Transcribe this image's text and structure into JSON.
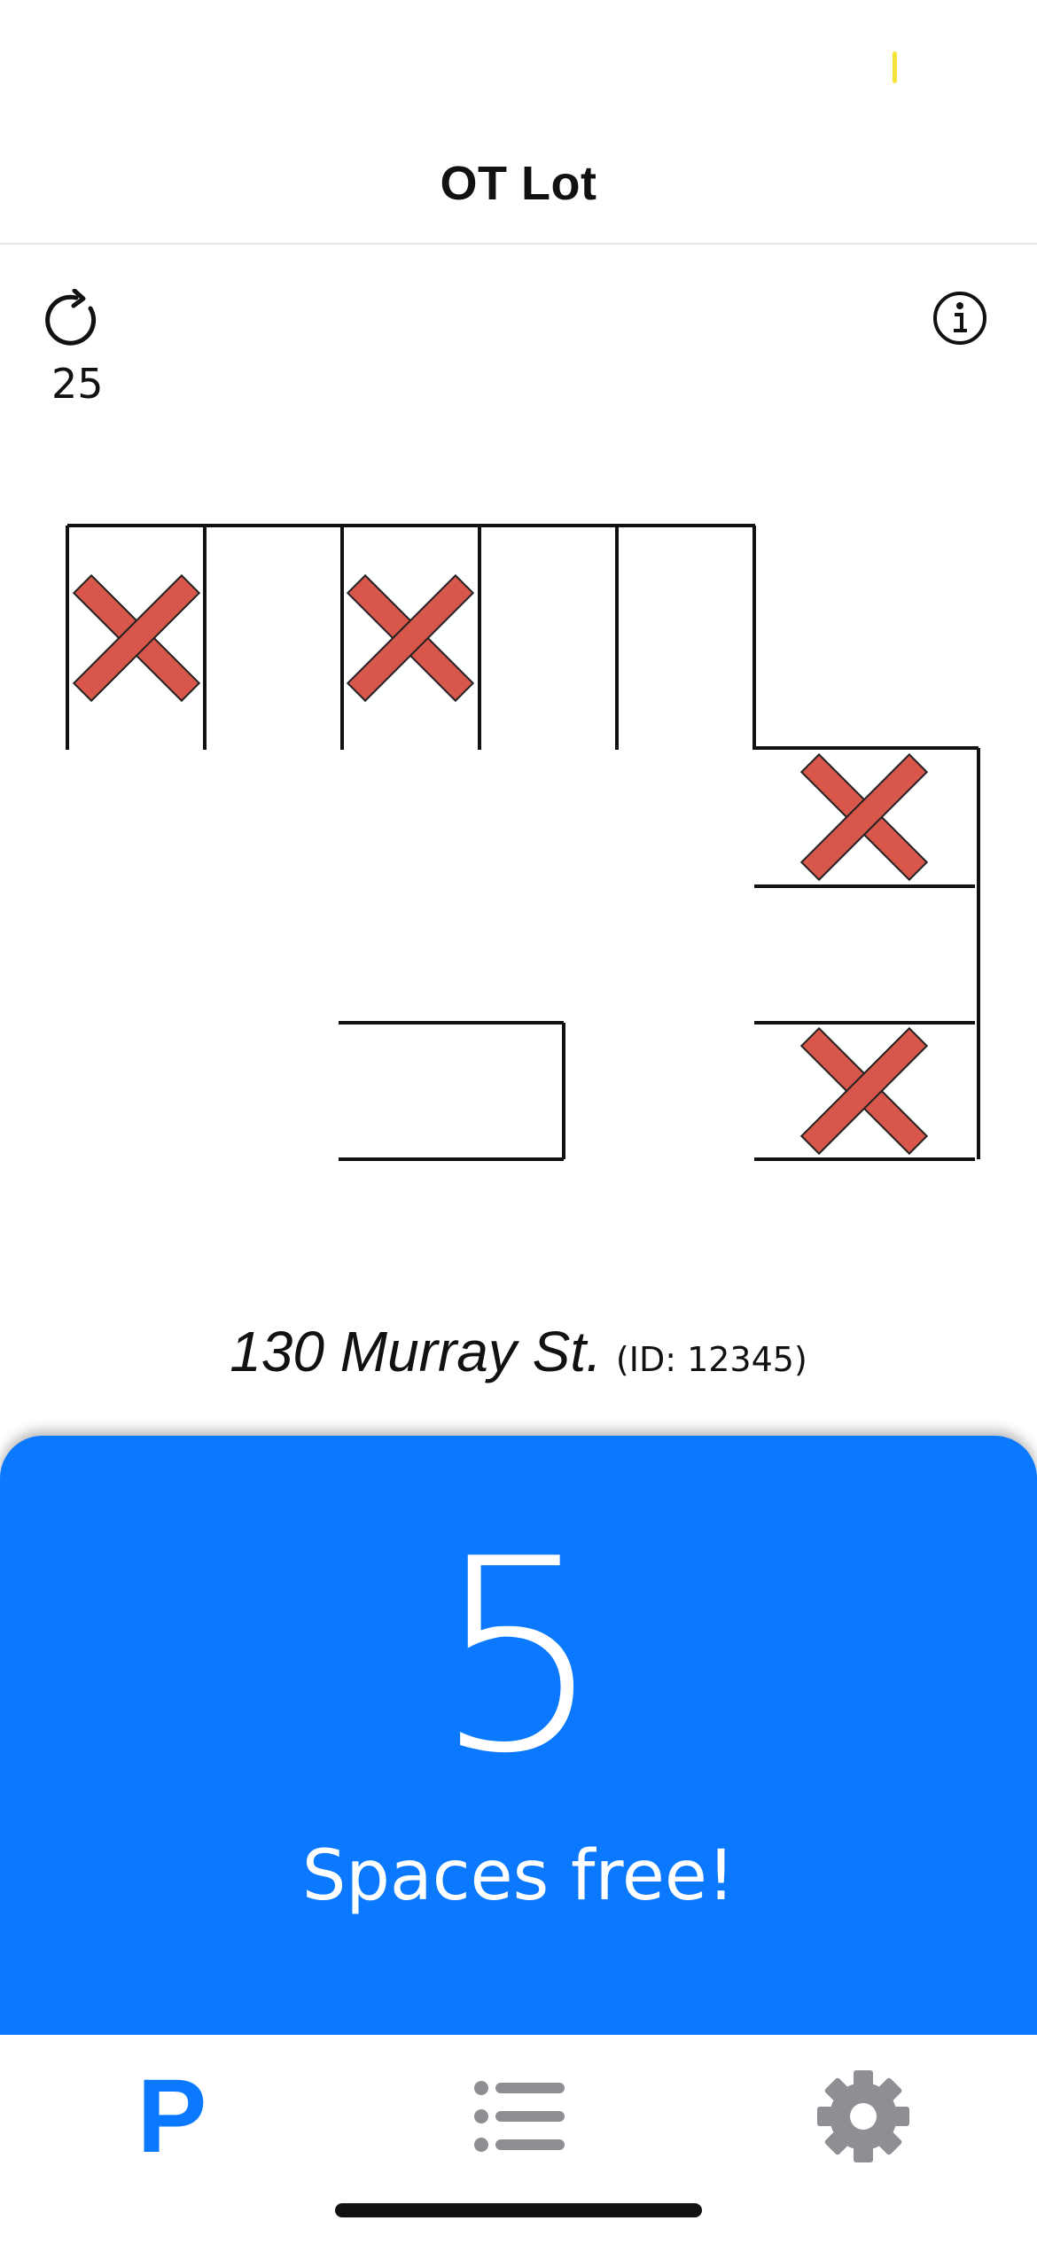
{
  "nav": {
    "title": "OT Lot"
  },
  "refresh": {
    "count": "25"
  },
  "lot": {
    "address": "130 Murray St.",
    "id_label": "(ID: 12345)",
    "occupied_color": "#d9574a",
    "spaces": [
      {
        "name": "space-top-1",
        "occupied": true
      },
      {
        "name": "space-top-2",
        "occupied": false
      },
      {
        "name": "space-top-3",
        "occupied": true
      },
      {
        "name": "space-top-4",
        "occupied": false
      },
      {
        "name": "space-top-5",
        "occupied": false
      },
      {
        "name": "space-right-1",
        "occupied": true
      },
      {
        "name": "space-right-2",
        "occupied": false
      },
      {
        "name": "space-right-3",
        "occupied": true
      },
      {
        "name": "space-middle-1",
        "occupied": false
      }
    ]
  },
  "summary": {
    "free_count": "5",
    "free_label": "Spaces free!",
    "panel_color": "#0a79ff"
  },
  "tabs": {
    "parking": {
      "label": "P",
      "icon": "parking-icon"
    },
    "list": {
      "icon": "list-icon"
    },
    "settings": {
      "icon": "gear-icon"
    }
  }
}
